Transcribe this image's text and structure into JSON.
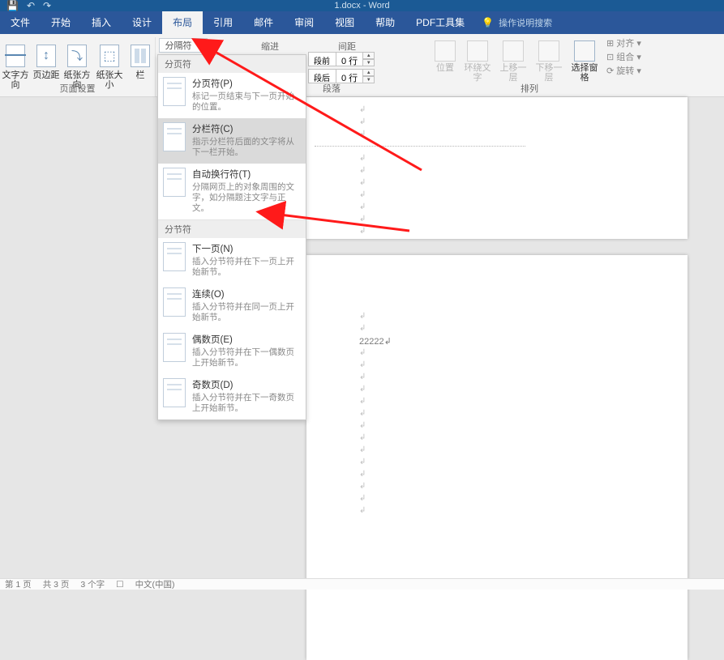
{
  "titlebar": {
    "doc_title": "1.docx - Word",
    "qat_save": "💾",
    "qat_undo": "↶",
    "qat_redo": "↷"
  },
  "tabs": {
    "file": "文件",
    "home": "开始",
    "insert": "插入",
    "design": "设计",
    "layout": "布局",
    "references": "引用",
    "mailings": "邮件",
    "review": "审阅",
    "view": "视图",
    "help": "帮助",
    "pdf": "PDF工具集",
    "hint_icon": "💡",
    "hint_text": "操作说明搜索"
  },
  "ribbon": {
    "page_setup": {
      "text_direction": "文字方向",
      "margins": "页边距",
      "orientation": "纸张方向",
      "size": "纸张大小",
      "columns": "栏",
      "group_label": "页面设置"
    },
    "breaks_trigger": "分隔符",
    "indent_header": "缩进",
    "spacing_header": "间距",
    "spacing": {
      "before_label": "段前",
      "after_label": "段后",
      "before_value": "0 行",
      "after_value": "0 行"
    },
    "para_group": "段落",
    "arrange": {
      "position": "位置",
      "wrap": "环绕文字",
      "forward": "上移一层",
      "backward": "下移一层",
      "selection_pane": "选择窗格",
      "align": "对齐",
      "group": "组合",
      "rotate": "旋转",
      "group_label": "排列"
    }
  },
  "menu": {
    "page_header": "分页符",
    "section_header": "分节符",
    "items": {
      "page_break": {
        "title": "分页符(P)",
        "desc": "标记一页结束与下一页开始的位置。"
      },
      "column_break": {
        "title": "分栏符(C)",
        "desc": "指示分栏符后面的文字将从下一栏开始。"
      },
      "text_wrap": {
        "title": "自动换行符(T)",
        "desc": "分隔网页上的对象周围的文字，如分隔题注文字与正文。"
      },
      "next_page": {
        "title": "下一页(N)",
        "desc": "插入分节符并在下一页上开始新节。"
      },
      "continuous": {
        "title": "连续(O)",
        "desc": "插入分节符并在同一页上开始新节。"
      },
      "even_page": {
        "title": "偶数页(E)",
        "desc": "插入分节符并在下一偶数页上开始新节。"
      },
      "odd_page": {
        "title": "奇数页(D)",
        "desc": "插入分节符并在下一奇数页上开始新节。"
      }
    }
  },
  "document": {
    "sample_text": "22222↲"
  },
  "status": {
    "page": "第 1 页",
    "total": "共 3 页",
    "words": "3 个字",
    "lang_icon": "☐",
    "lang": "中文(中国)"
  }
}
